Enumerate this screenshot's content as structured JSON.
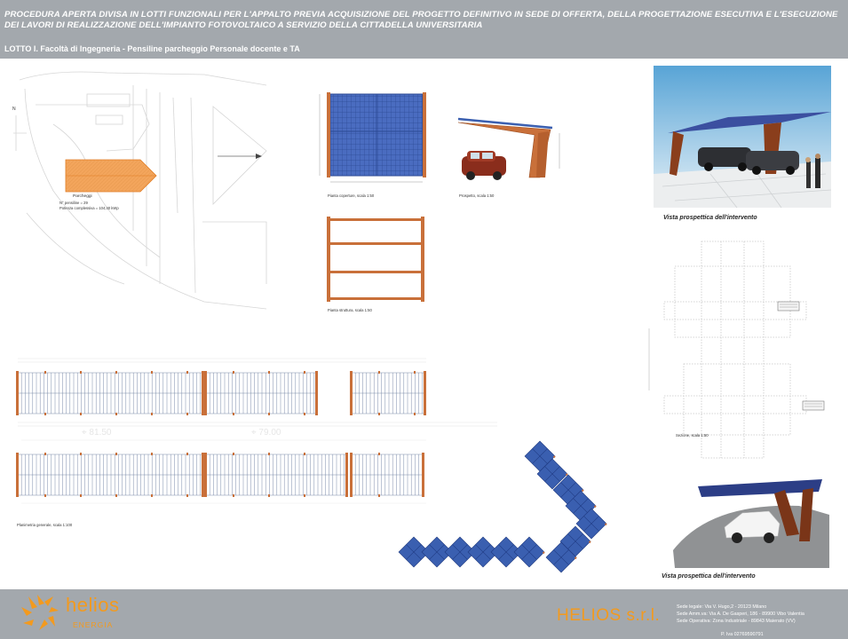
{
  "header": {
    "title_line1": "PROCEDURA APERTA  DIVISA IN LOTTI FUNZIONALI PER L'APPALTO PREVIA ACQUISIZIONE DEL PROGETTO DEFINITIVO IN SEDE DI OFFERTA, DELLA PROGETTAZIONE ESECUTIVA E L'ESECUZIONE",
    "title_line2": "DEI LAVORI DI REALIZZAZIONE DELL'IMPIANTO FOTOVOLTAICO A SERVIZIO DELLA CITTADELLA UNIVERSITARIA",
    "lotto": "LOTTO I. Facoltà di Ingegneria - Pensiline parcheggio Personale docente e TA"
  },
  "site_plan": {
    "label_parcheggi": "Parcheggi",
    "label_pensiline": "N° pensiline = 29",
    "label_potenza": "Potenza complessiva = 104,40 kWp",
    "north_label": "N"
  },
  "captions": {
    "pianta_coperture": "Pianta coperture, scala 1:50",
    "prospetto": "Prospetto, scala 1:50",
    "pianta_struttura": "Pianta struttura, scala 1:50",
    "vista1": "Vista prospettica dell'intervento",
    "vista2": "Vista prospettica dell'intervento",
    "sezione": "Sezione, scala 1:50",
    "planimetria": "Planimetria generale, scala 1:100"
  },
  "dimensions": {
    "left": "81.50",
    "right": "79.00"
  },
  "footer": {
    "logo_word": "helios",
    "logo_sub": "ENERGIA",
    "company": "HELIOS s.r.l.",
    "address_line1": "Sede legale:   Via V. Hugo,2 - 20123 Milano",
    "address_line2": "Sede Amm.va: Via A. De Gasperi, 186 - 89900 Vibo Valentia",
    "address_line3": "Sede Operativa: Zona Industriale - 89843 Maierato (VV)",
    "vat": "P. Iva  02769590791"
  },
  "colors": {
    "header_bg": "#a3a8ad",
    "accent_orange": "#f39a1e",
    "panel_blue": "#3a5fb0",
    "frame_rust": "#c9703a"
  }
}
